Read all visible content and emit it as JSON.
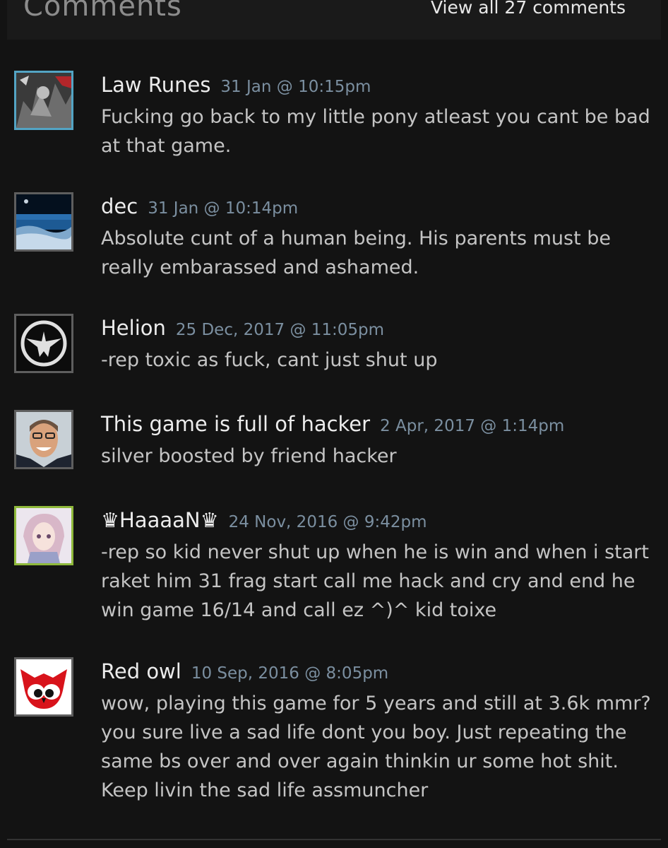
{
  "header": {
    "title": "Comments",
    "view_all_label": "View all 27 comments"
  },
  "comments": [
    {
      "author": "Law Runes",
      "timestamp": "31 Jan @ 10:15pm",
      "text": "Fucking go back to my little pony atleast you cant be bad at that game.",
      "status": "online",
      "avatar_icon": "grayscale-character-avatar-icon"
    },
    {
      "author": "dec",
      "timestamp": "31 Jan @ 10:14pm",
      "text": "Absolute cunt of a human being. His parents must be really embarassed and ashamed.",
      "status": "offline",
      "avatar_icon": "earth-from-space-avatar-icon"
    },
    {
      "author": "Helion",
      "timestamp": "25 Dec, 2017 @ 11:05pm",
      "text": "-rep toxic as fuck, cant just shut up",
      "status": "offline",
      "avatar_icon": "eagle-emblem-avatar-icon"
    },
    {
      "author": "This game is full of hacker",
      "timestamp": "2 Apr, 2017 @ 1:14pm",
      "text": "silver boosted by friend hacker",
      "status": "offline",
      "avatar_icon": "smiling-man-avatar-icon"
    },
    {
      "author": "♛HaaaaN♛",
      "timestamp": "24 Nov, 2016 @ 9:42pm",
      "text": "-rep so kid never shut up when he is win and when i start raket him 31 frag start call me hack and cry and end he win game 16/14 and call ez ^)^ kid toixe",
      "status": "ingame",
      "avatar_icon": "anime-character-avatar-icon"
    },
    {
      "author": "Red owl",
      "timestamp": "10 Sep, 2016 @ 8:05pm",
      "text": "wow, playing this game for 5 years and still at 3.6k mmr? you sure live a sad life dont you boy. Just repeating the same bs over and over again thinkin ur some hot shit. Keep livin the sad life assmuncher",
      "status": "offline",
      "avatar_icon": "red-owl-logo-avatar-icon"
    }
  ],
  "colors": {
    "background": "#131313",
    "author": "#ececec",
    "timestamp": "#7b8fa0",
    "text": "#c4c4c4",
    "online_border": "#53a4c4",
    "ingame_border": "#8fb93b"
  }
}
